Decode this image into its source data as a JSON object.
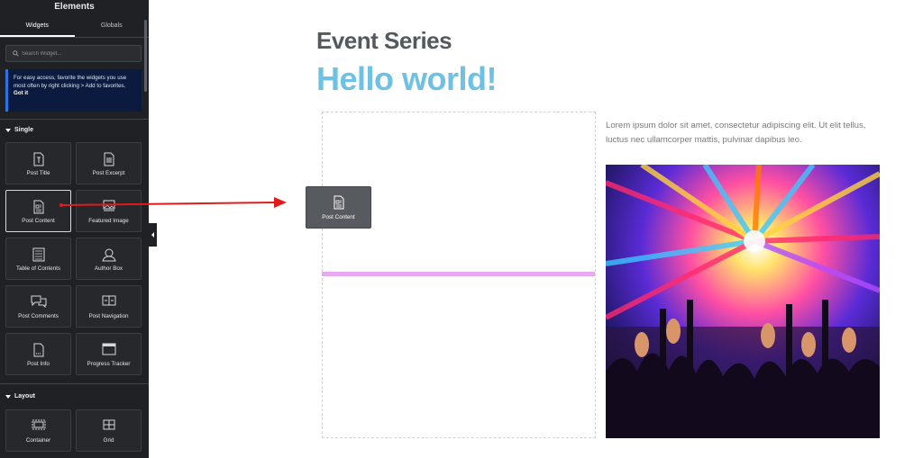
{
  "panel": {
    "title": "Elements",
    "tabs": [
      {
        "label": "Widgets",
        "active": true
      },
      {
        "label": "Globals",
        "active": false
      }
    ],
    "search": {
      "placeholder": "Search Widget..."
    },
    "notice": {
      "text": "For easy access, favorite the widgets you use most often by right clicking > Add to favorites.",
      "link": "Got it"
    },
    "sections": [
      {
        "label": "Single"
      },
      {
        "label": "Layout"
      }
    ],
    "widgets": [
      {
        "label": "Post Title",
        "icon": "post-title-icon"
      },
      {
        "label": "Post Excerpt",
        "icon": "post-excerpt-icon"
      },
      {
        "label": "Post Content",
        "icon": "post-content-icon",
        "selected": true
      },
      {
        "label": "Featured Image",
        "icon": "featured-image-icon"
      },
      {
        "label": "Table of Contents",
        "icon": "table-of-contents-icon"
      },
      {
        "label": "Author Box",
        "icon": "author-box-icon"
      },
      {
        "label": "Post Comments",
        "icon": "post-comments-icon"
      },
      {
        "label": "Post Navigation",
        "icon": "post-navigation-icon"
      },
      {
        "label": "Post Info",
        "icon": "post-info-icon"
      },
      {
        "label": "Progress Tracker",
        "icon": "progress-tracker-icon"
      },
      {
        "label": "Container",
        "icon": "container-icon"
      },
      {
        "label": "Grid",
        "icon": "grid-icon"
      }
    ]
  },
  "canvas": {
    "subtitle": "Event Series",
    "title": "Hello world!",
    "drag_ghost_label": "Post Content",
    "paragraph": "Lorem ipsum dolor sit amet, consectetur adipiscing elit. Ut elit tellus, luctus nec ullamcorper mattis, pulvinar dapibus leo.",
    "image": "concert-photo"
  },
  "colors": {
    "panel_bg": "#1f2124",
    "title_accent": "#6ec1e4",
    "subtitle": "#54595f",
    "drop_indicator": "#e9a9f0",
    "arrow": "#e11b1b",
    "notice_bg": "#0b1a3f"
  }
}
